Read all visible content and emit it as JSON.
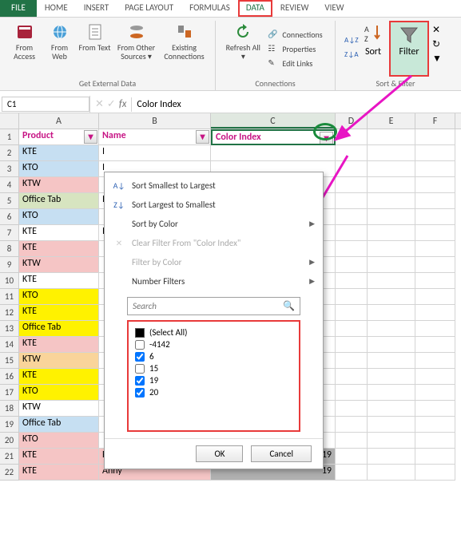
{
  "tabs": {
    "file": "FILE",
    "home": "HOME",
    "insert": "INSERT",
    "page_layout": "PAGE LAYOUT",
    "formulas": "FORMULAS",
    "data": "DATA",
    "review": "REVIEW",
    "view": "VIEW"
  },
  "ribbon": {
    "from_access": "From Access",
    "from_web": "From Web",
    "from_text": "From Text",
    "from_other": "From Other Sources ▾",
    "existing": "Existing Connections",
    "refresh": "Refresh All ▾",
    "connections": "Connections",
    "properties": "Properties",
    "edit_links": "Edit Links",
    "sort": "Sort",
    "filter": "Filter",
    "group_external": "Get External Data",
    "group_conn": "Connections",
    "group_sort": "Sort & Filter"
  },
  "formula_bar": {
    "cell_ref": "C1",
    "content": "Color Index",
    "fx": "fx"
  },
  "columns": [
    "A",
    "B",
    "C",
    "D",
    "E",
    "F"
  ],
  "headers": {
    "a": "Product",
    "b": "Name",
    "c": "Color Index"
  },
  "data_rows": [
    {
      "n": 2,
      "a": "KTE",
      "b": "I",
      "aColor": "bg-blue"
    },
    {
      "n": 3,
      "a": "KTO",
      "b": "I",
      "aColor": "bg-blue"
    },
    {
      "n": 4,
      "a": "KTW",
      "b": "",
      "aColor": "bg-pink"
    },
    {
      "n": 5,
      "a": "Office Tab",
      "b": "I",
      "aColor": "bg-green"
    },
    {
      "n": 6,
      "a": "KTO",
      "b": "",
      "aColor": "bg-blue"
    },
    {
      "n": 7,
      "a": "KTE",
      "b": "I",
      "aColor": ""
    },
    {
      "n": 8,
      "a": "KTE",
      "b": "",
      "aColor": "bg-pink"
    },
    {
      "n": 9,
      "a": "KTW",
      "b": "",
      "aColor": "bg-pink"
    },
    {
      "n": 10,
      "a": "KTE",
      "b": "",
      "aColor": ""
    },
    {
      "n": 11,
      "a": "KTO",
      "b": "",
      "aColor": "bg-yellow"
    },
    {
      "n": 12,
      "a": "KTE",
      "b": "",
      "aColor": "bg-yellow"
    },
    {
      "n": 13,
      "a": "Office Tab",
      "b": "",
      "aColor": "bg-yellow"
    },
    {
      "n": 14,
      "a": "KTE",
      "b": "",
      "aColor": "bg-pink"
    },
    {
      "n": 15,
      "a": "KTW",
      "b": "",
      "aColor": "bg-orange"
    },
    {
      "n": 16,
      "a": "KTE",
      "b": "",
      "aColor": "bg-yellow"
    },
    {
      "n": 17,
      "a": "KTO",
      "b": "",
      "aColor": "bg-yellow"
    },
    {
      "n": 18,
      "a": "KTW",
      "b": "",
      "aColor": ""
    },
    {
      "n": 19,
      "a": "Office Tab",
      "b": "",
      "aColor": "bg-blue"
    },
    {
      "n": 20,
      "a": "KTO",
      "b": "",
      "aColor": "bg-pink"
    }
  ],
  "extra_rows": [
    {
      "n": 21,
      "a": "KTE",
      "b": "Ruby",
      "c": "19",
      "aColor": "bg-pink",
      "bColor": "bg-pink"
    },
    {
      "n": 22,
      "a": "KTE",
      "b": "Anny",
      "c": "19",
      "aColor": "bg-pink",
      "bColor": "bg-pink"
    }
  ],
  "filter_menu": {
    "sort_asc": "Sort Smallest to Largest",
    "sort_desc": "Sort Largest to Smallest",
    "sort_color": "Sort by Color",
    "clear": "Clear Filter From \"Color Index\"",
    "filter_color": "Filter by Color",
    "number_filters": "Number Filters",
    "search_placeholder": "Search",
    "select_all": "(Select All)",
    "items": [
      {
        "label": "-4142",
        "checked": false
      },
      {
        "label": "6",
        "checked": true
      },
      {
        "label": "15",
        "checked": false
      },
      {
        "label": "19",
        "checked": true
      },
      {
        "label": "20",
        "checked": true
      }
    ],
    "ok": "OK",
    "cancel": "Cancel"
  }
}
